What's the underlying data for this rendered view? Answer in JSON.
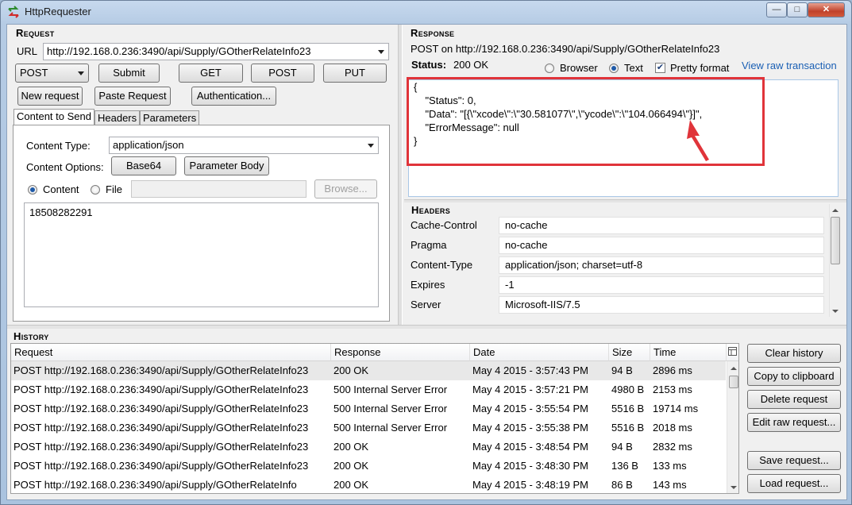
{
  "window": {
    "title": "HttpRequester",
    "minimize": "—",
    "maximize": "□",
    "close": "✕"
  },
  "request": {
    "section_title": "Request",
    "url_label": "URL",
    "url_value": "http://192.168.0.236:3490/api/Supply/GOtherRelateInfo23",
    "method": "POST",
    "buttons": {
      "submit": "Submit",
      "get": "GET",
      "post": "POST",
      "put": "PUT",
      "new_request": "New request",
      "paste_request": "Paste Request",
      "authentication": "Authentication..."
    },
    "tabs": [
      "Content to Send",
      "Headers",
      "Parameters"
    ],
    "content_type_label": "Content Type:",
    "content_type_value": "application/json",
    "content_options_label": "Content Options:",
    "base64": "Base64",
    "parameter_body": "Parameter Body",
    "content_radio": "Content",
    "file_radio": "File",
    "browse": "Browse...",
    "body_text": "18508282291"
  },
  "response": {
    "section_title": "Response",
    "summary": "POST on http://192.168.0.236:3490/api/Supply/GOtherRelateInfo23",
    "status_label": "Status:",
    "status_value": "200 OK",
    "browser_radio": "Browser",
    "text_radio": "Text",
    "pretty_format": "Pretty format",
    "view_raw": "View raw transaction",
    "body_lines": [
      "{",
      "    \"Status\": 0,",
      "    \"Data\": \"[{\\\"xcode\\\":\\\"30.581077\\\",\\\"ycode\\\":\\\"104.066494\\\"}]\",",
      "    \"ErrorMessage\": null",
      "}"
    ],
    "highlight_color": "#e0343a"
  },
  "headers": {
    "section_title": "Headers",
    "rows": [
      {
        "name": "Cache-Control",
        "value": "no-cache"
      },
      {
        "name": "Pragma",
        "value": "no-cache"
      },
      {
        "name": "Content-Type",
        "value": "application/json; charset=utf-8"
      },
      {
        "name": "Expires",
        "value": "-1"
      },
      {
        "name": "Server",
        "value": "Microsoft-IIS/7.5"
      }
    ]
  },
  "history": {
    "section_title": "History",
    "columns": [
      "Request",
      "Response",
      "Date",
      "Size",
      "Time"
    ],
    "rows": [
      {
        "request": "POST http://192.168.0.236:3490/api/Supply/GOtherRelateInfo23",
        "response": "200 OK",
        "date": "May 4 2015 - 3:57:43 PM",
        "size": "94 B",
        "time": "2896 ms"
      },
      {
        "request": "POST http://192.168.0.236:3490/api/Supply/GOtherRelateInfo23",
        "response": "500 Internal Server Error",
        "date": "May 4 2015 - 3:57:21 PM",
        "size": "4980 B",
        "time": "2153 ms"
      },
      {
        "request": "POST http://192.168.0.236:3490/api/Supply/GOtherRelateInfo23",
        "response": "500 Internal Server Error",
        "date": "May 4 2015 - 3:55:54 PM",
        "size": "5516 B",
        "time": "19714 ms"
      },
      {
        "request": "POST http://192.168.0.236:3490/api/Supply/GOtherRelateInfo23",
        "response": "500 Internal Server Error",
        "date": "May 4 2015 - 3:55:38 PM",
        "size": "5516 B",
        "time": "2018 ms"
      },
      {
        "request": "POST http://192.168.0.236:3490/api/Supply/GOtherRelateInfo23",
        "response": "200 OK",
        "date": "May 4 2015 - 3:48:54 PM",
        "size": "94 B",
        "time": "2832 ms"
      },
      {
        "request": "POST http://192.168.0.236:3490/api/Supply/GOtherRelateInfo23",
        "response": "200 OK",
        "date": "May 4 2015 - 3:48:30 PM",
        "size": "136 B",
        "time": "133 ms"
      },
      {
        "request": "POST http://192.168.0.236:3490/api/Supply/GOtherRelateInfo",
        "response": "200 OK",
        "date": "May 4 2015 - 3:48:19 PM",
        "size": "86 B",
        "time": "143 ms"
      }
    ],
    "buttons": {
      "clear": "Clear history",
      "copy": "Copy to clipboard",
      "delete": "Delete request",
      "edit_raw": "Edit raw request...",
      "save": "Save request...",
      "load": "Load request..."
    }
  }
}
